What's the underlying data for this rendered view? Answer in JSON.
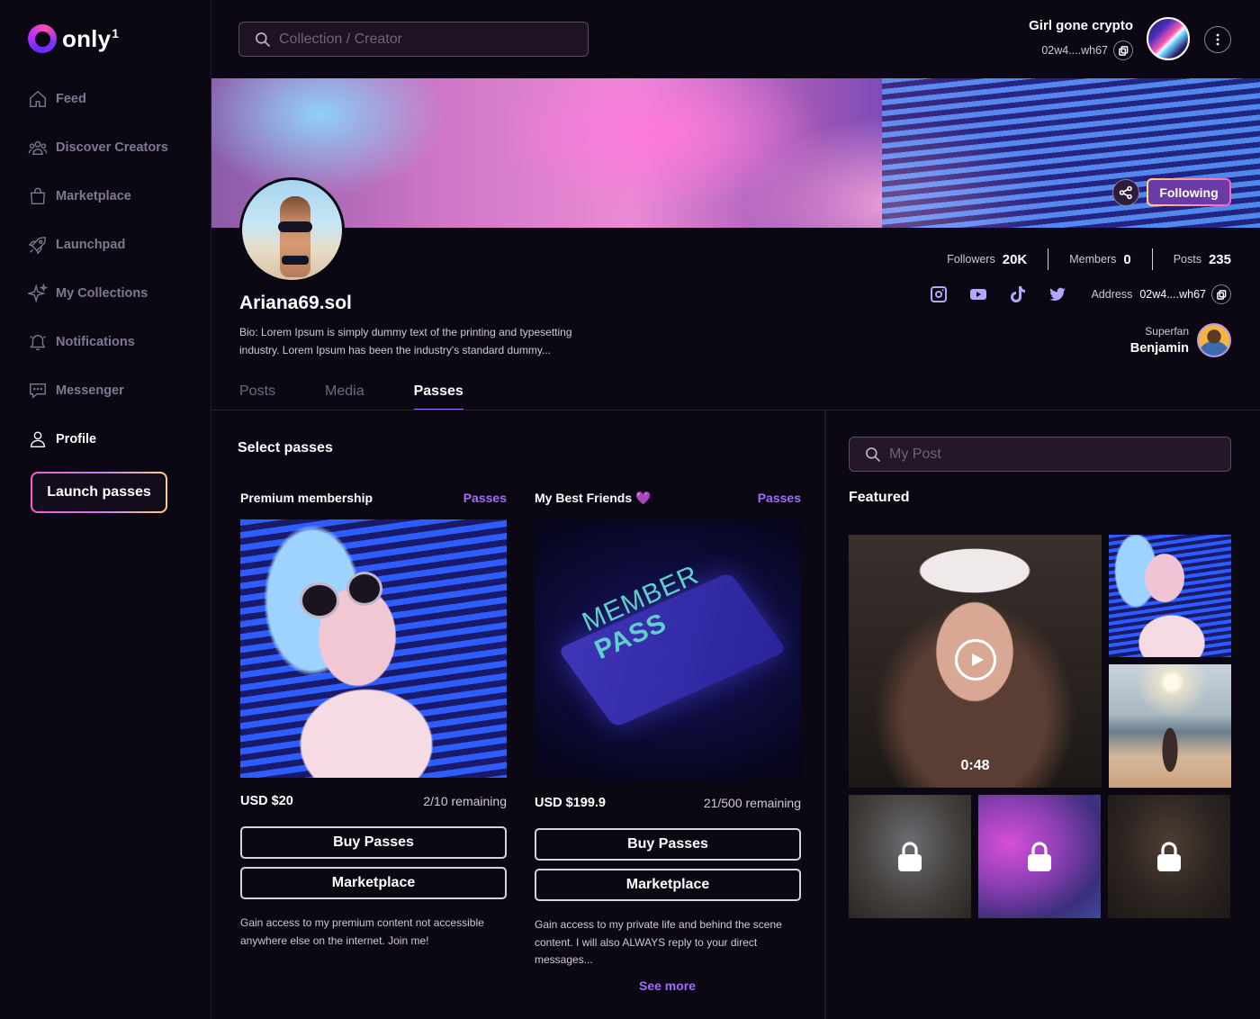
{
  "app": {
    "logo_text": "only",
    "logo_sup": "1"
  },
  "sidebar": {
    "items": [
      {
        "label": "Feed",
        "icon": "home-icon"
      },
      {
        "label": "Discover Creators",
        "icon": "users-icon"
      },
      {
        "label": "Marketplace",
        "icon": "bag-icon"
      },
      {
        "label": "Launchpad",
        "icon": "rocket-icon"
      },
      {
        "label": "My Collections",
        "icon": "sparkle-icon"
      },
      {
        "label": "Notifications",
        "icon": "bell-icon"
      },
      {
        "label": "Messenger",
        "icon": "chat-icon"
      },
      {
        "label": "Profile",
        "icon": "user-icon",
        "active": true
      }
    ],
    "launch_label": "Launch passes"
  },
  "topbar": {
    "search_placeholder": "Collection / Creator",
    "user_name": "Girl gone crypto",
    "user_address": "02w4....wh67"
  },
  "banner": {
    "following_label": "Following"
  },
  "profile": {
    "name": "Ariana69.sol",
    "bio": "Bio: Lorem Ipsum is simply dummy text of the printing and typesetting industry. Lorem Ipsum has been the industry's standard dummy...",
    "stats": {
      "followers_label": "Followers",
      "followers_value": "20K",
      "members_label": "Members",
      "members_value": "0",
      "posts_label": "Posts",
      "posts_value": "235"
    },
    "socials": [
      "instagram-icon",
      "youtube-icon",
      "tiktok-icon",
      "twitter-icon"
    ],
    "address_label": "Address",
    "address_value": "02w4....wh67",
    "superfan_label": "Superfan",
    "superfan_name": "Benjamin"
  },
  "tabs": [
    {
      "label": "Posts"
    },
    {
      "label": "Media"
    },
    {
      "label": "Passes",
      "active": true
    }
  ],
  "passes": {
    "title": "Select passes",
    "items": [
      {
        "name": "Premium membership",
        "tag": "Passes",
        "price": "USD $20",
        "remaining": "2/10 remaining",
        "buy_label": "Buy Passes",
        "market_label": "Marketplace",
        "description": "Gain access to my premium content not accessible anywhere else on the internet. Join me!"
      },
      {
        "name": "My Best Friends 💜",
        "tag": "Passes",
        "image_text_line1": "MEMBER",
        "image_text_line2": "PASS",
        "price": "USD $199.9",
        "remaining": "21/500 remaining",
        "buy_label": "Buy Passes",
        "market_label": "Marketplace",
        "description": "Gain access to my private life and behind the scene content. I will also ALWAYS reply to your direct messages..."
      }
    ],
    "see_more": "See more"
  },
  "featured": {
    "search_placeholder": "My Post",
    "title": "Featured",
    "video_duration": "0:48"
  }
}
